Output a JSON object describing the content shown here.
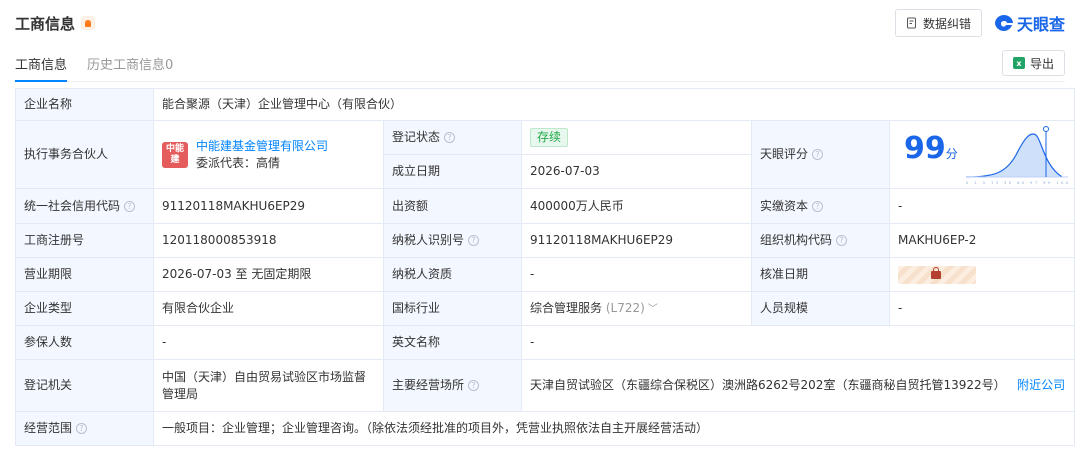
{
  "header": {
    "title": "工商信息",
    "feedback_label": "数据纠错",
    "brand": "天眼查"
  },
  "tabs": [
    {
      "label": "工商信息",
      "active": true
    },
    {
      "label": "历史工商信息0",
      "active": false
    }
  ],
  "export_label": "导出",
  "table": {
    "company_name_label": "企业名称",
    "company_name": "能合聚源（天津）企业管理中心（有限合伙）",
    "partner_label": "执行事务合伙人",
    "partner_logo": "中能建",
    "partner_name": "中能建基金管理有限公司",
    "partner_rep": "委派代表：高倩",
    "reg_status_label": "登记状态",
    "reg_status": "存续",
    "found_date_label": "成立日期",
    "found_date": "2026-07-03",
    "score_label": "天眼评分",
    "score": "99",
    "score_unit": "分",
    "score_ticks": "0 1 3 15 30 60 97 99 100",
    "credit_code_label": "统一社会信用代码",
    "credit_code": "91120118MAKHU6EP29",
    "capital_label": "出资额",
    "capital": "400000万人民币",
    "paid_capital_label": "实缴资本",
    "paid_capital": "-",
    "reg_no_label": "工商注册号",
    "reg_no": "120118000853918",
    "tax_id_label": "纳税人识别号",
    "tax_id": "91120118MAKHU6EP29",
    "org_code_label": "组织机构代码",
    "org_code": "MAKHU6EP-2",
    "term_label": "营业期限",
    "term": "2026-07-03 至 无固定期限",
    "taxpayer_label": "纳税人资质",
    "taxpayer": "-",
    "approve_date_label": "核准日期",
    "type_label": "企业类型",
    "type": "有限合伙企业",
    "industry_label": "国标行业",
    "industry": "综合管理服务",
    "industry_code": "(L722)",
    "staff_label": "人员规模",
    "staff": "-",
    "insured_label": "参保人数",
    "insured": "-",
    "english_label": "英文名称",
    "english": "-",
    "authority_label": "登记机关",
    "authority": "中国（天津）自由贸易试验区市场监督管理局",
    "address_label": "主要经营场所",
    "address": "天津自贸试验区（东疆综合保税区）澳洲路6262号202室（东疆商秘自贸托管13922号）",
    "nearby_label": "附近公司",
    "scope_label": "经营范围",
    "scope": "一般项目：企业管理；企业管理咨询。（除依法须经批准的项目外，凭营业执照依法自主开展经营活动）"
  },
  "colors": {
    "accent": "#0084ff",
    "brand": "#1a66e8",
    "status_green": "#22a84a",
    "key_bg": "#f3f7ff"
  }
}
